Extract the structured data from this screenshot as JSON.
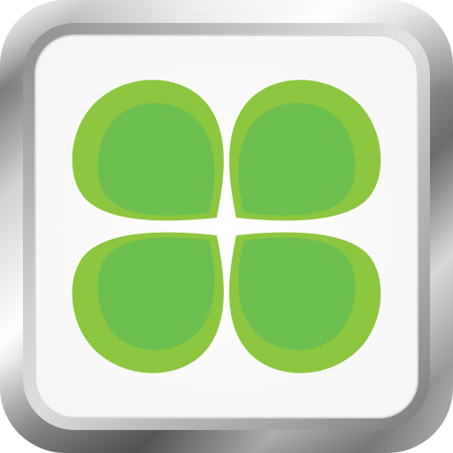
{
  "icon": {
    "name": "clover-icon",
    "leaf_count": 4,
    "colors": {
      "leaf_outer": "#8DC63F",
      "leaf_inner": "#6CBE4F",
      "panel": "#FFFFFF",
      "frame_light": "#F7F7F7",
      "frame_mid": "#B9B9B9",
      "frame_dark": "#4A4A4A"
    }
  }
}
